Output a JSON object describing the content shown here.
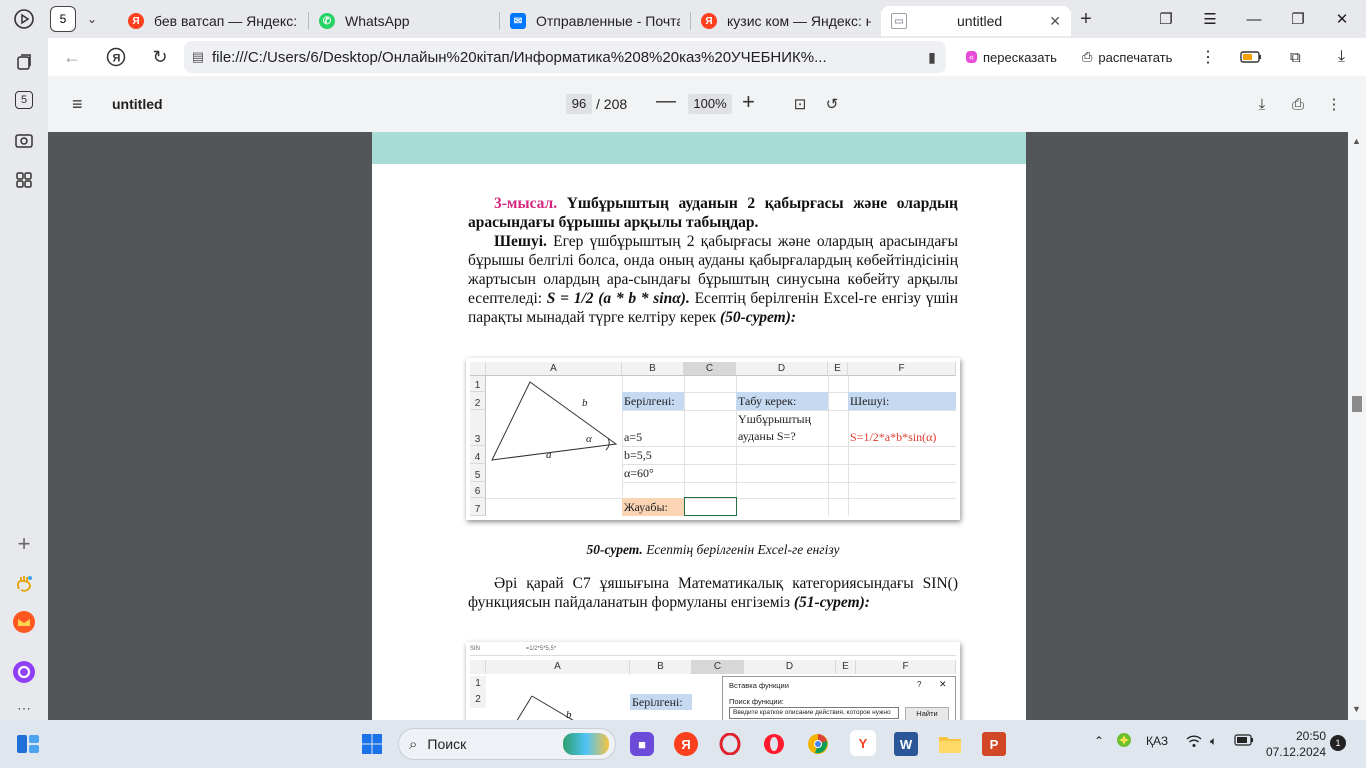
{
  "browser": {
    "tab_count": "5",
    "tabs": [
      {
        "title": "бев ватсап — Яндекс: на",
        "favicon": "yandex-icon",
        "color": "#fc3f1d"
      },
      {
        "title": "WhatsApp",
        "favicon": "whatsapp-icon",
        "color": "#25d366"
      },
      {
        "title": "Отправленные - Почта М",
        "favicon": "mail-icon",
        "color": "#0077ff"
      },
      {
        "title": "кузис ком — Яндекс: на",
        "favicon": "yandex-icon",
        "color": "#fc3f1d"
      },
      {
        "title": "untitled",
        "favicon": "file-icon",
        "color": "#9aa0a6"
      }
    ],
    "url": "file:///C:/Users/6/Desktop/Онлайын%20кітап/Информатика%208%20каз%20УЧЕБНИК%...",
    "retell_label": "пересказать",
    "print_label": "распечатать",
    "sidebar_badge": "5"
  },
  "pdf": {
    "title": "untitled",
    "page_current": "96",
    "page_total": "/ 208",
    "zoom": "100%"
  },
  "document": {
    "example_label": "3-мысал.",
    "example_text": " Үшбұрыштың ауданын 2 қабырғасы және олардың арасындағы бұрышы арқылы табыңдар.",
    "solution_label": "Шешуі.",
    "solution_text": " Егер үшбұрыштың 2 қабырғасы және олардың арасындағы бұрышы белгілі болса, онда оның ауданы қабырғалардың көбейтіндісінің жартысын олардың ара-сындағы бұрыштың синусына көбейту арқылы есептеледі: ",
    "formula": "S = 1/2 (a * b * sinα).",
    "solution_text2": " Есептің берілгенін Excel-ге енгізу үшін парақты мынадай түрге келтіру керек ",
    "ref1": "(50-сурет):",
    "caption_label": "50-сурет.",
    "caption_text": " Есептің берілгенін Excel-ге енгізу",
    "next_text": "Әрі қарай С7 ұяшығына Математикалық категориясындағы SIN() функциясын пайдаланатын формуланы енгіземіз ",
    "ref2": "(51-сурет):"
  },
  "figure1": {
    "columns": [
      "A",
      "B",
      "C",
      "D",
      "E",
      "F"
    ],
    "rows": [
      "1",
      "2",
      "3",
      "4",
      "5",
      "6",
      "7"
    ],
    "given_label": "Берілгені:",
    "find_label": "Табу керек:",
    "solution_header": "Шешуі:",
    "find_text_1": "Үшбұрыштың",
    "find_text_2": "ауданы  S=?",
    "formula": "S=1/2*a*b*sin(α)",
    "a_value": "a=5",
    "b_value": "b=5,5",
    "alpha_value": "α=60°",
    "answer_label": "Жауабы:",
    "tri_a": "a",
    "tri_b": "b",
    "tri_alpha": "α",
    "given_color": "#c5d9f1",
    "answer_color": "#fbd4b4",
    "formula_color": "#e03c31"
  },
  "figure2": {
    "name_box": "SIN",
    "formula_bar": "=1/2*5*5,5*",
    "columns": [
      "A",
      "B",
      "C",
      "D",
      "E",
      "F"
    ],
    "rows": [
      "1",
      "2"
    ],
    "given_label": "Берілгені:",
    "tri_b": "b",
    "dialog_title": "Вставка функции",
    "dialog_q": "?",
    "dialog_close": "✕",
    "dialog_search_label": "Поиск функции:",
    "dialog_input": "Введите краткое описание действия, которое нужно",
    "dialog_button": "Найти"
  },
  "taskbar": {
    "search_label": "Поиск",
    "lang": "ҚАЗ",
    "time": "20:50",
    "date": "07.12.2024",
    "notifications": "1"
  }
}
